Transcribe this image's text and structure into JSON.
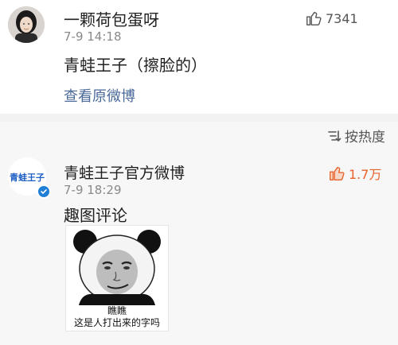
{
  "comment": {
    "username": "一颗荷包蛋呀",
    "timestamp": "7-9 14:18",
    "text": "青蛙王子（擦脸的）",
    "like_count": "7341",
    "view_original_link": "查看原微博"
  },
  "sort": {
    "label": "按热度",
    "icon": "sort-icon"
  },
  "reply": {
    "avatar_text": "青蛙王子",
    "username": "青蛙王子官方微博",
    "timestamp": "7-9 18:29",
    "text": "趣图评论",
    "like_count": "1.7万",
    "verified": true,
    "meme_caption_line1": "瞧瞧",
    "meme_caption_line2": "这是人打出来的字吗"
  },
  "colors": {
    "link": "#4a6a9a",
    "like_active": "#e8622b",
    "verified": "#1e7fd6",
    "brand_blue": "#1f5fc4"
  }
}
